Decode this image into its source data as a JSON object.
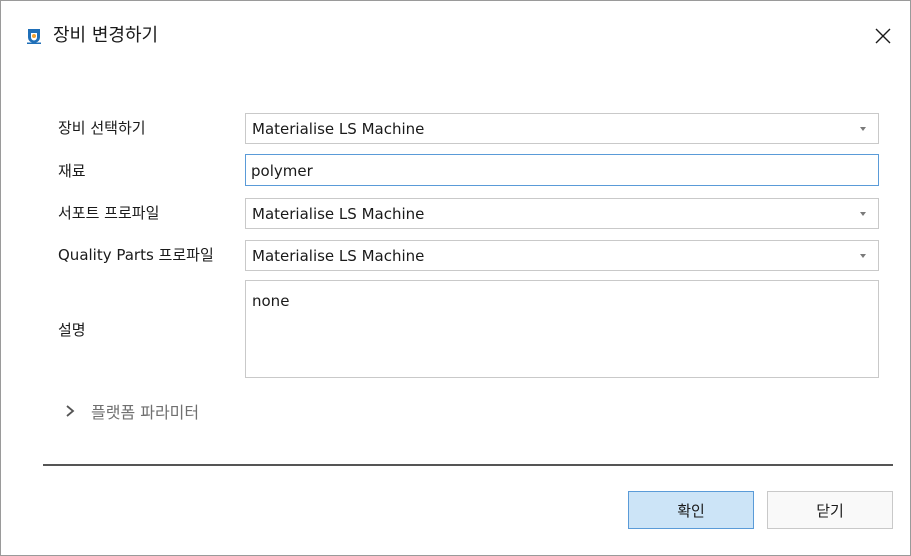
{
  "window": {
    "title": "장비 변경하기",
    "icon": "app-logo-icon",
    "close_icon": "close-icon"
  },
  "form": {
    "machine": {
      "label": "장비 선택하기",
      "value": "Materialise LS Machine"
    },
    "material": {
      "label": "재료",
      "value": "polymer"
    },
    "support_profile": {
      "label": "서포트 프로파일",
      "value": "Materialise LS Machine"
    },
    "quality_profile": {
      "label": "Quality Parts 프로파일",
      "value": "Materialise LS Machine"
    },
    "description": {
      "label": "설명",
      "value": "none"
    }
  },
  "expander": {
    "label": "플랫폼 파라미터",
    "icon": "chevron-right-icon",
    "expanded": false
  },
  "buttons": {
    "ok": "확인",
    "close": "닫기"
  },
  "colors": {
    "ok_button_bg": "#cce4f7",
    "focus_border": "#5a9bd8",
    "app_icon_blue": "#1f6fb8",
    "app_icon_orange": "#f0a030"
  }
}
